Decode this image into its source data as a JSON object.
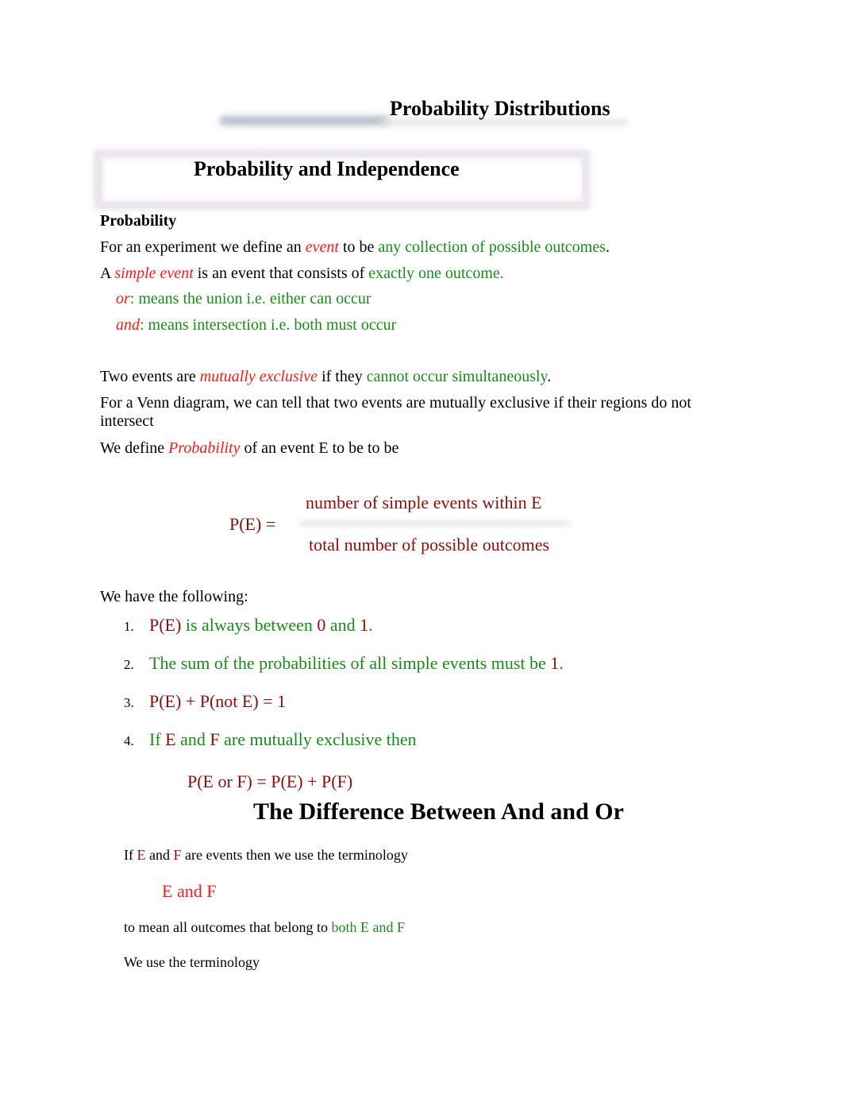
{
  "document": {
    "title": "Probability Distributions",
    "section_title": "Probability and Independence",
    "subheading": "Probability",
    "paragraphs": {
      "event_def": {
        "pre": "For an experiment we define an ",
        "term": "event",
        "mid": " to be ",
        "def": "any collection of possible outcomes",
        "post": "."
      },
      "simple_event_def": {
        "pre": "A ",
        "term": "simple event",
        "mid": " is an event that consists of ",
        "def": "exactly one outcome."
      },
      "or_def": {
        "term": "or",
        "def": ": means the union i.e. either can occur"
      },
      "and_def": {
        "term": "and",
        "def": ": means intersection i.e. both must occur"
      },
      "mutually_exclusive": {
        "pre": "Two events are ",
        "term": "mutually exclusive",
        "mid": " if they ",
        "def": "cannot occur simultaneously",
        "post": "."
      },
      "venn_line1": "For a Venn diagram, we can tell that two events are mutually exclusive if their regions do not",
      "venn_line2": "intersect",
      "prob_def": {
        "pre": "We define ",
        "term": "Probability",
        "post": "  of an event E to be to be"
      }
    },
    "formula": {
      "lhs": "P(E) =",
      "numerator": "number of simple events within E",
      "denominator": "total number of possible outcomes"
    },
    "properties_intro": "We have the following:",
    "properties": [
      {
        "num": "1.",
        "parts": [
          "P(E)",
          " is always between ",
          "0",
          " and ",
          "1",
          "."
        ]
      },
      {
        "num": "2.",
        "parts": [
          "The sum of the probabilities of all simple events must be ",
          "1",
          "."
        ]
      },
      {
        "num": "3.",
        "parts": [
          "P(E) + P(not E) = 1"
        ]
      },
      {
        "num": "4.",
        "parts": [
          "If ",
          "E",
          " and ",
          "F",
          " are mutually exclusive then"
        ]
      }
    ],
    "addition_rule": "P(E or F) = P(E) + P(F)",
    "section2_title": "The Difference Between And and Or",
    "terminology_line": {
      "pre": "If ",
      "e": "E",
      "mid": " and ",
      "f": "F",
      "post": " are events then we use the terminology"
    },
    "e_and_f": "E and F",
    "meaning_line": {
      "pre": "to mean all outcomes that belong to ",
      "def": "both E and F"
    },
    "we_use_line": "We use the terminology"
  },
  "colors": {
    "term_red": "#ff1a1a",
    "definition_green": "#1a8a1a",
    "formula_maroon": "#8b0d0d"
  }
}
